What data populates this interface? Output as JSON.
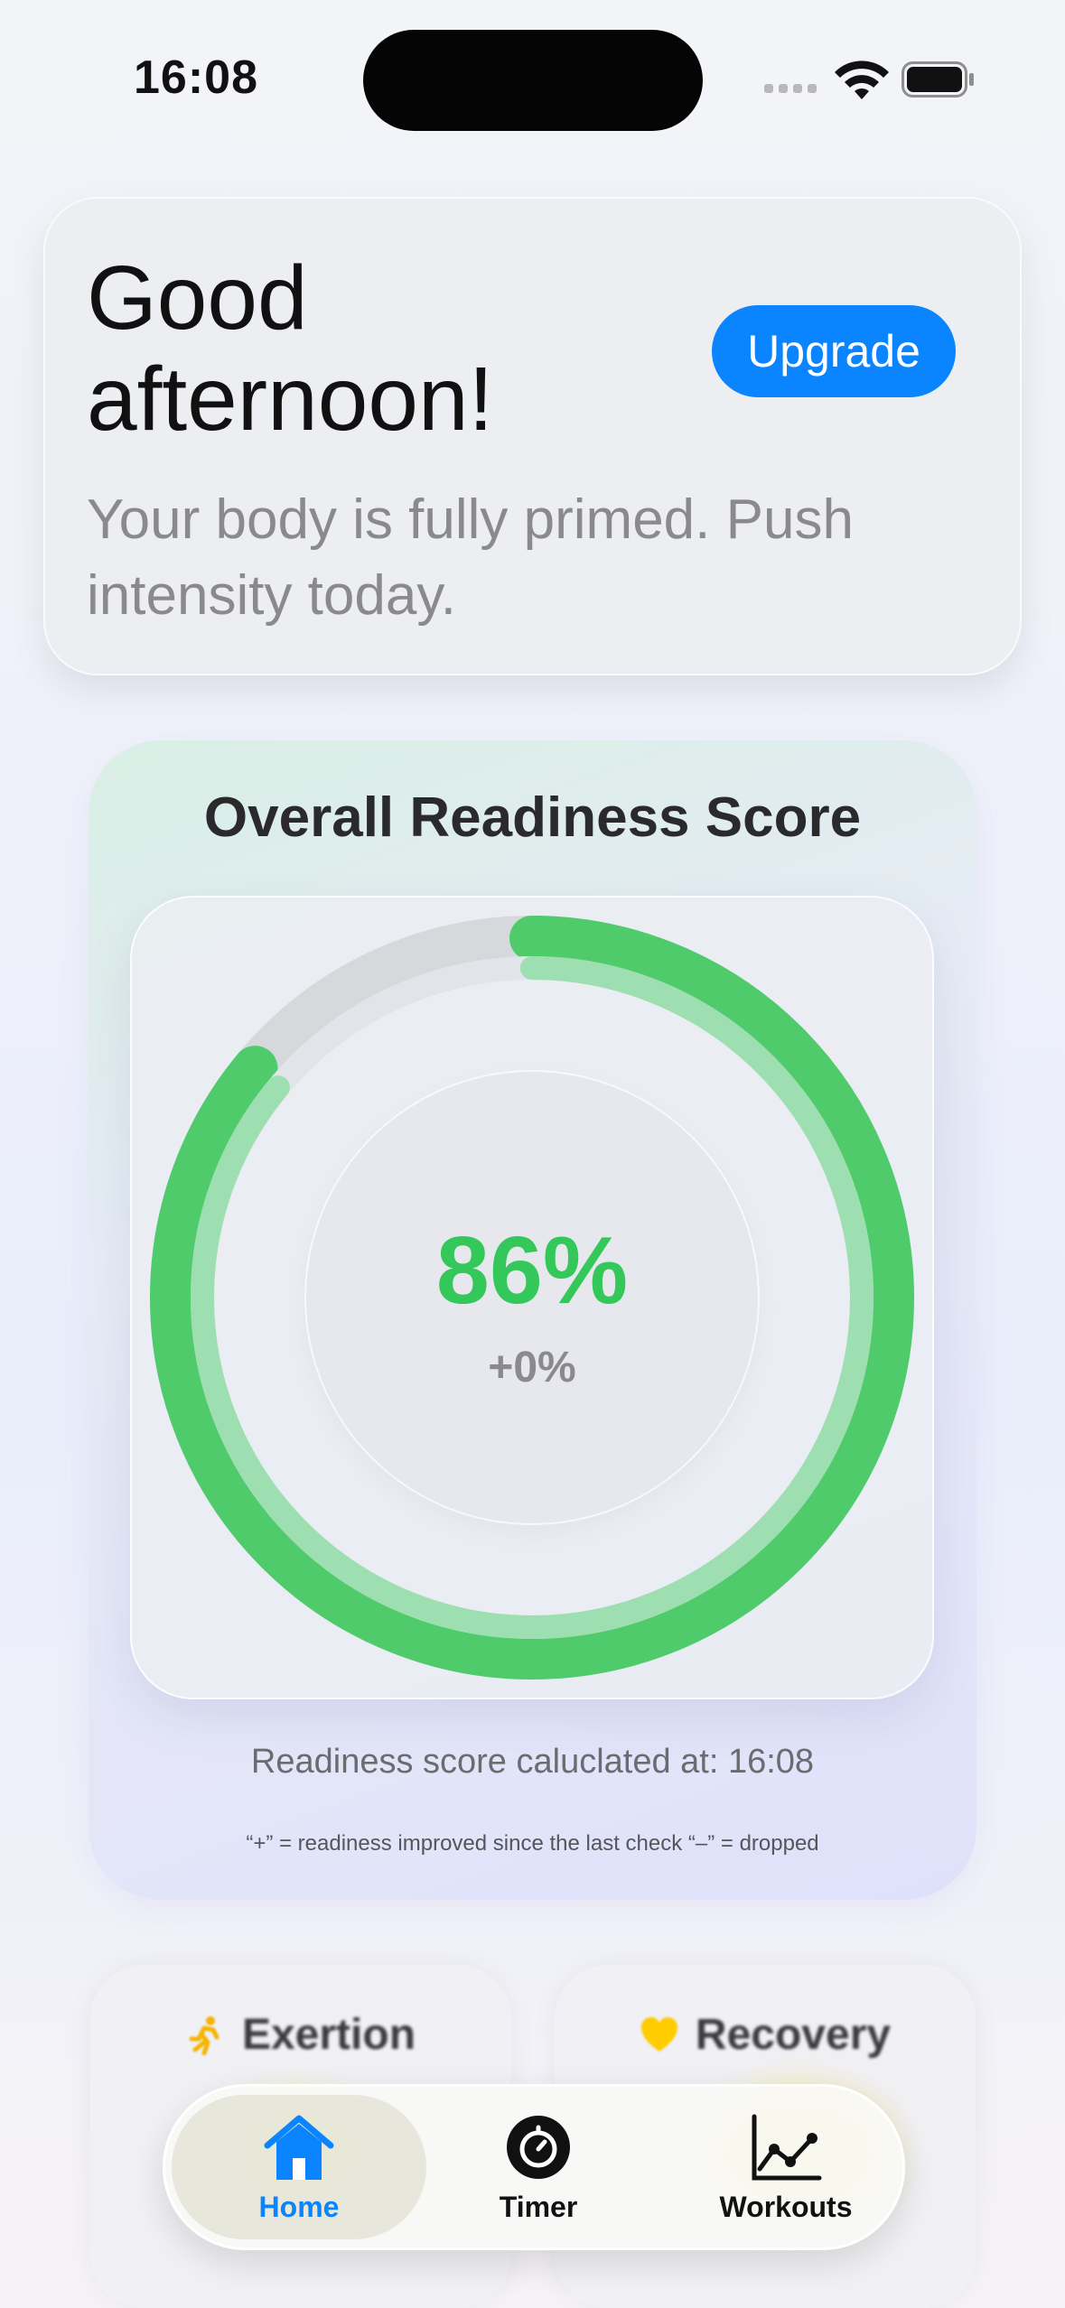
{
  "status_bar": {
    "time": "16:08",
    "icons": [
      "cellular-icon",
      "wifi-icon",
      "battery-icon"
    ]
  },
  "greeting": {
    "title": "Good afternoon!",
    "subtitle": "Your body is fully primed. Push intensity today.",
    "upgrade_label": "Upgrade"
  },
  "readiness": {
    "title": "Overall Readiness Score",
    "score": "86%",
    "score_fraction": 0.86,
    "delta": "+0%",
    "calculated_at": "Readiness score caluclated at: 16:08",
    "legend": "“+” = readiness improved since the last check “–” = dropped"
  },
  "cards": [
    {
      "title": "Exertion",
      "icon": "running-icon"
    },
    {
      "title": "Recovery",
      "icon": "heart-icon"
    }
  ],
  "tab_bar": {
    "items": [
      {
        "label": "Home",
        "icon": "home-icon",
        "active": true
      },
      {
        "label": "Timer",
        "icon": "timer-icon",
        "active": false
      },
      {
        "label": "Workouts",
        "icon": "chart-icon",
        "active": false
      }
    ]
  },
  "colors": {
    "accent": "#0a84ff",
    "ring_green": "#34c759",
    "exertion_icon": "#f5b400",
    "heart": "#ffcc00"
  }
}
